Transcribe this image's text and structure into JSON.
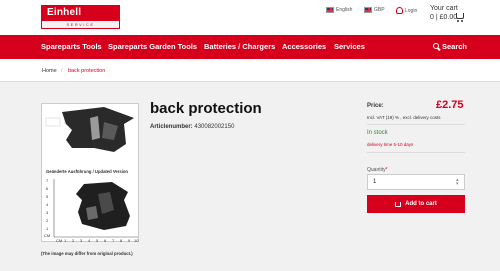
{
  "header": {
    "logo_text": "Einhell",
    "logo_sub": "SERVICE",
    "language": "English",
    "currency": "GBP",
    "login": "Login",
    "cart_title": "Your cart",
    "cart_summary": "0 | £0.00"
  },
  "nav": {
    "items": [
      "Spareparts Tools",
      "Spareparts Garden Tools",
      "Batteries / Chargers",
      "Accessories",
      "Services"
    ],
    "search": "Search"
  },
  "breadcrumb": {
    "home": "Home",
    "separator": "/",
    "current": "back protection"
  },
  "product": {
    "title": "back protection",
    "article_label": "Articlenumber:",
    "article_number": "430082002150",
    "image_caption": "(The image may differ from original product.)",
    "image_inner_caption": "Geänderte Ausführung / Updated Version"
  },
  "buybox": {
    "price_label": "Price:",
    "price": "£2.75",
    "vat_note": "Incl. VAT (19) % , excl. delivery costs",
    "stock": "In stock",
    "delivery": "delivery time 5-10 days",
    "quantity_label": "Quantity",
    "quantity_required": "*",
    "quantity_value": "1",
    "add_to_cart": "Add to cart"
  },
  "colors": {
    "brand_red": "#d6001c",
    "stock_green": "#2a8a2a"
  }
}
